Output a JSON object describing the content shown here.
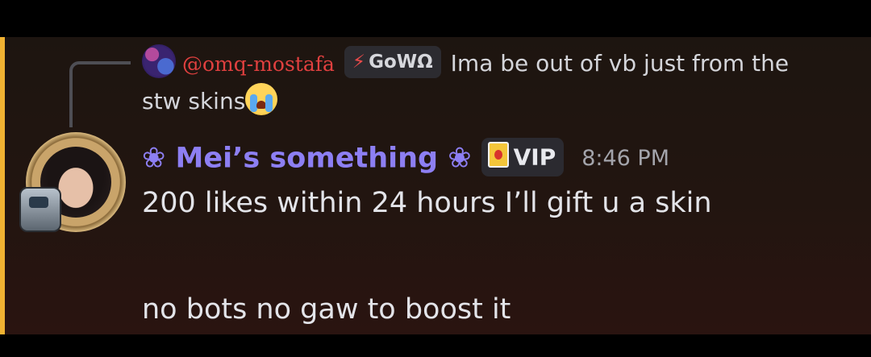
{
  "reply": {
    "author": "@omq-mostafa",
    "tag_icon": "lightning-bolt-icon",
    "tag": "GoWΩ",
    "text_line1": "Ima be out of vb just from the",
    "text_line2": "stw skins",
    "emoji": "loudly-crying-face-emoji"
  },
  "message": {
    "author": "❀ Mei’s something ❀",
    "role_badge": "VIP",
    "role_icon": "vip-shield-icon",
    "timestamp": "8:46 PM",
    "lines": [
      "200 likes within 24 hours I’ll gift u a skin",
      "",
      "no bots no gaw to boost it"
    ]
  },
  "colors": {
    "highlight_bar": "#f0b232",
    "author_name": "#8d7ff3",
    "reply_name": "#e0403f",
    "text": "#e3e4e9",
    "timestamp": "#a3a4ab"
  }
}
